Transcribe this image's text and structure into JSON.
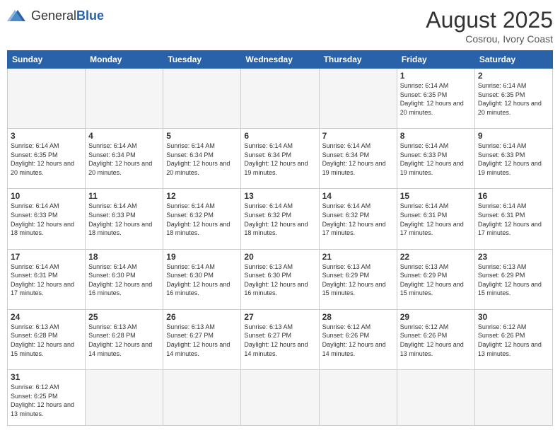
{
  "header": {
    "logo_general": "General",
    "logo_blue": "Blue",
    "month_title": "August 2025",
    "subtitle": "Cosrou, Ivory Coast"
  },
  "days_of_week": [
    "Sunday",
    "Monday",
    "Tuesday",
    "Wednesday",
    "Thursday",
    "Friday",
    "Saturday"
  ],
  "weeks": [
    [
      {
        "day": "",
        "empty": true
      },
      {
        "day": "",
        "empty": true
      },
      {
        "day": "",
        "empty": true
      },
      {
        "day": "",
        "empty": true
      },
      {
        "day": "",
        "empty": true
      },
      {
        "day": "1",
        "sunrise": "6:14 AM",
        "sunset": "6:35 PM",
        "daylight": "12 hours and 20 minutes."
      },
      {
        "day": "2",
        "sunrise": "6:14 AM",
        "sunset": "6:35 PM",
        "daylight": "12 hours and 20 minutes."
      }
    ],
    [
      {
        "day": "3",
        "sunrise": "6:14 AM",
        "sunset": "6:35 PM",
        "daylight": "12 hours and 20 minutes."
      },
      {
        "day": "4",
        "sunrise": "6:14 AM",
        "sunset": "6:34 PM",
        "daylight": "12 hours and 20 minutes."
      },
      {
        "day": "5",
        "sunrise": "6:14 AM",
        "sunset": "6:34 PM",
        "daylight": "12 hours and 20 minutes."
      },
      {
        "day": "6",
        "sunrise": "6:14 AM",
        "sunset": "6:34 PM",
        "daylight": "12 hours and 19 minutes."
      },
      {
        "day": "7",
        "sunrise": "6:14 AM",
        "sunset": "6:34 PM",
        "daylight": "12 hours and 19 minutes."
      },
      {
        "day": "8",
        "sunrise": "6:14 AM",
        "sunset": "6:33 PM",
        "daylight": "12 hours and 19 minutes."
      },
      {
        "day": "9",
        "sunrise": "6:14 AM",
        "sunset": "6:33 PM",
        "daylight": "12 hours and 19 minutes."
      }
    ],
    [
      {
        "day": "10",
        "sunrise": "6:14 AM",
        "sunset": "6:33 PM",
        "daylight": "12 hours and 18 minutes."
      },
      {
        "day": "11",
        "sunrise": "6:14 AM",
        "sunset": "6:33 PM",
        "daylight": "12 hours and 18 minutes."
      },
      {
        "day": "12",
        "sunrise": "6:14 AM",
        "sunset": "6:32 PM",
        "daylight": "12 hours and 18 minutes."
      },
      {
        "day": "13",
        "sunrise": "6:14 AM",
        "sunset": "6:32 PM",
        "daylight": "12 hours and 18 minutes."
      },
      {
        "day": "14",
        "sunrise": "6:14 AM",
        "sunset": "6:32 PM",
        "daylight": "12 hours and 17 minutes."
      },
      {
        "day": "15",
        "sunrise": "6:14 AM",
        "sunset": "6:31 PM",
        "daylight": "12 hours and 17 minutes."
      },
      {
        "day": "16",
        "sunrise": "6:14 AM",
        "sunset": "6:31 PM",
        "daylight": "12 hours and 17 minutes."
      }
    ],
    [
      {
        "day": "17",
        "sunrise": "6:14 AM",
        "sunset": "6:31 PM",
        "daylight": "12 hours and 17 minutes."
      },
      {
        "day": "18",
        "sunrise": "6:14 AM",
        "sunset": "6:30 PM",
        "daylight": "12 hours and 16 minutes."
      },
      {
        "day": "19",
        "sunrise": "6:14 AM",
        "sunset": "6:30 PM",
        "daylight": "12 hours and 16 minutes."
      },
      {
        "day": "20",
        "sunrise": "6:13 AM",
        "sunset": "6:30 PM",
        "daylight": "12 hours and 16 minutes."
      },
      {
        "day": "21",
        "sunrise": "6:13 AM",
        "sunset": "6:29 PM",
        "daylight": "12 hours and 15 minutes."
      },
      {
        "day": "22",
        "sunrise": "6:13 AM",
        "sunset": "6:29 PM",
        "daylight": "12 hours and 15 minutes."
      },
      {
        "day": "23",
        "sunrise": "6:13 AM",
        "sunset": "6:29 PM",
        "daylight": "12 hours and 15 minutes."
      }
    ],
    [
      {
        "day": "24",
        "sunrise": "6:13 AM",
        "sunset": "6:28 PM",
        "daylight": "12 hours and 15 minutes."
      },
      {
        "day": "25",
        "sunrise": "6:13 AM",
        "sunset": "6:28 PM",
        "daylight": "12 hours and 14 minutes."
      },
      {
        "day": "26",
        "sunrise": "6:13 AM",
        "sunset": "6:27 PM",
        "daylight": "12 hours and 14 minutes."
      },
      {
        "day": "27",
        "sunrise": "6:13 AM",
        "sunset": "6:27 PM",
        "daylight": "12 hours and 14 minutes."
      },
      {
        "day": "28",
        "sunrise": "6:12 AM",
        "sunset": "6:26 PM",
        "daylight": "12 hours and 14 minutes."
      },
      {
        "day": "29",
        "sunrise": "6:12 AM",
        "sunset": "6:26 PM",
        "daylight": "12 hours and 13 minutes."
      },
      {
        "day": "30",
        "sunrise": "6:12 AM",
        "sunset": "6:26 PM",
        "daylight": "12 hours and 13 minutes."
      }
    ],
    [
      {
        "day": "31",
        "sunrise": "6:12 AM",
        "sunset": "6:25 PM",
        "daylight": "12 hours and 13 minutes."
      },
      {
        "day": "",
        "empty": true
      },
      {
        "day": "",
        "empty": true
      },
      {
        "day": "",
        "empty": true
      },
      {
        "day": "",
        "empty": true
      },
      {
        "day": "",
        "empty": true
      },
      {
        "day": "",
        "empty": true
      }
    ]
  ],
  "labels": {
    "sunrise": "Sunrise:",
    "sunset": "Sunset:",
    "daylight": "Daylight:"
  }
}
